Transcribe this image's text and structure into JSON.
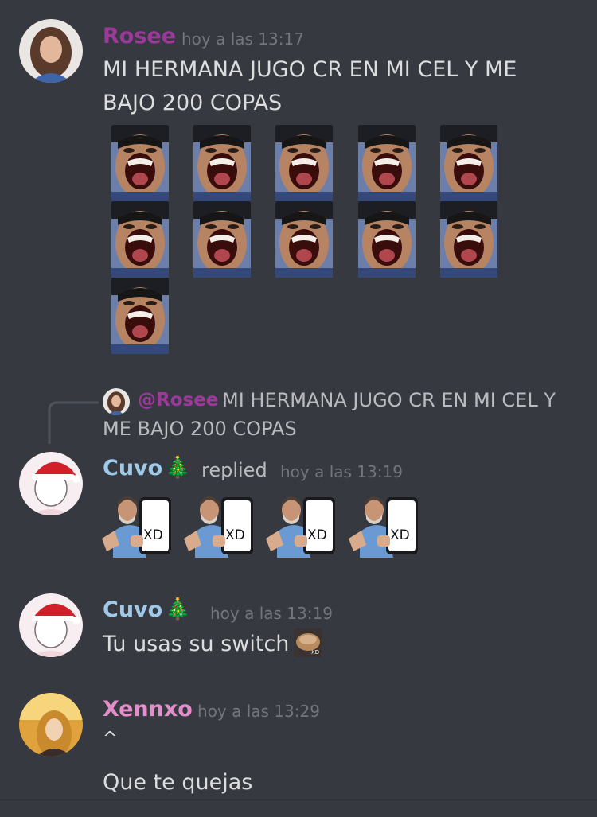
{
  "messages": {
    "rosee": {
      "author": "Rosee",
      "time": "hoy a las 13:17",
      "line1": "MI HERMANA JUGO CR EN MI CEL Y ME",
      "line2": "BAJO 200 COPAS",
      "name_color": "#9b3a9b",
      "emote_count": 11
    },
    "reply": {
      "mention": "@Rosee",
      "text1": "MI HERMANA JUGO CR EN MI CEL Y",
      "text2": "ME BAJO 200 COPAS"
    },
    "cuvo1": {
      "author": "Cuvo",
      "tree": "🎄",
      "replied": "replied",
      "time": "hoy a las 13:19",
      "name_color": "#9ec9e9",
      "xd_label": "XD",
      "xd_count": 4
    },
    "cuvo2": {
      "author": "Cuvo",
      "tree": "🎄",
      "time": "hoy a las 13:19",
      "text": "Tu usas su switch",
      "emoji_label": "XD"
    },
    "xennxo": {
      "author": "Xennxo",
      "time": "hoy a las 13:29",
      "line1": "^",
      "line2": "Que te quejas",
      "name_color": "#e48ecb"
    }
  }
}
